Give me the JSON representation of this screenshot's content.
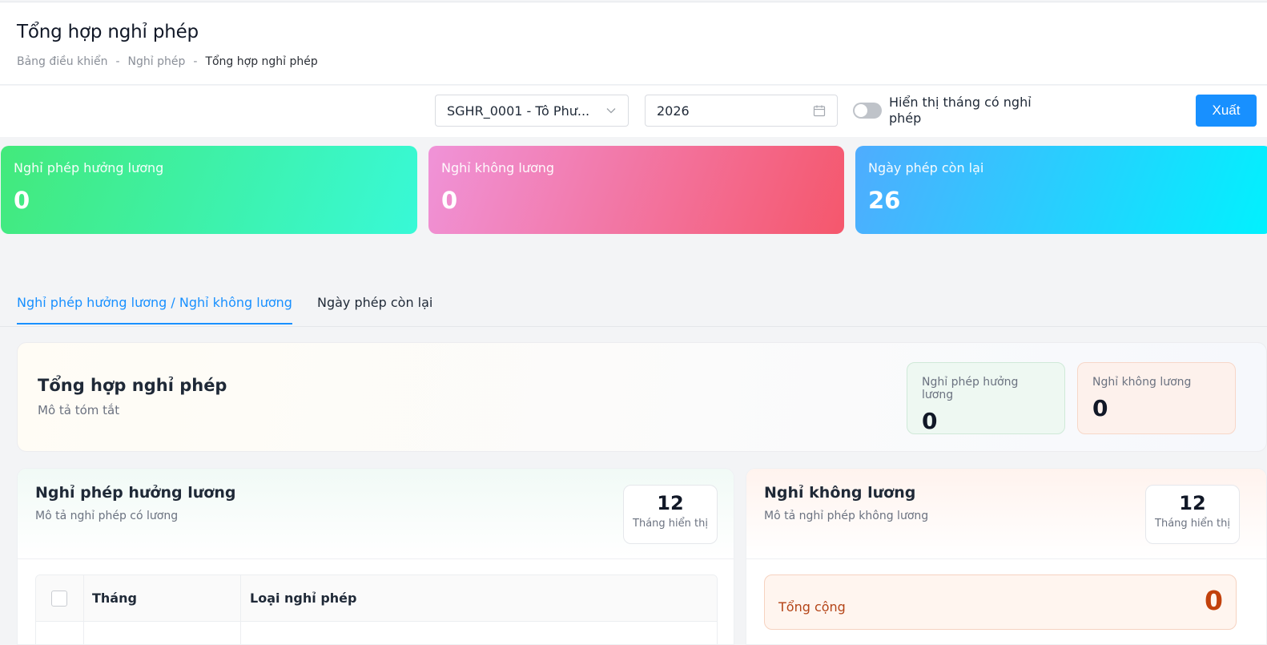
{
  "header": {
    "title": "Tổng hợp nghỉ phép",
    "breadcrumb": [
      "Bảng điều khiển",
      "Nghỉ phép",
      "Tổng hợp nghỉ phép"
    ],
    "breadcrumb_sep": "-"
  },
  "filters": {
    "employee_select": "SGHR_0001 - Tô Phư...",
    "year": "2026",
    "toggle_label": "Hiển thị tháng có nghỉ phép",
    "toggle_on": false,
    "export_label": "Xuất"
  },
  "stats": [
    {
      "label": "Nghỉ phép hưởng lương",
      "value": "0"
    },
    {
      "label": "Nghỉ không lương",
      "value": "0"
    },
    {
      "label": "Ngày phép còn lại",
      "value": "26"
    }
  ],
  "tabs": [
    {
      "label": "Nghỉ phép hưởng lương / Nghỉ không lương",
      "active": true
    },
    {
      "label": "Ngày phép còn lại",
      "active": false
    }
  ],
  "summary": {
    "title": "Tổng hợp nghỉ phép",
    "description": "Mô tả tóm tắt",
    "paid": {
      "label": "Nghỉ phép hưởng lương",
      "value": "0"
    },
    "unpaid": {
      "label": "Nghỉ không lương",
      "value": "0"
    }
  },
  "paid_panel": {
    "title": "Nghỉ phép hưởng lương",
    "description": "Mô tả nghỉ phép có lương",
    "count": "12",
    "count_caption": "Tháng hiển thị",
    "columns": [
      "Tháng",
      "Loại nghỉ phép"
    ]
  },
  "unpaid_panel": {
    "title": "Nghỉ không lương",
    "description": "Mô tả nghỉ phép không lương",
    "count": "12",
    "count_caption": "Tháng hiển thị",
    "total_label": "Tổng cộng",
    "total_value": "0"
  },
  "colors": {
    "primary": "#1890ff",
    "green_card": "#43e97b",
    "pink_card": "#f5576c",
    "blue_card": "#4facfe",
    "total_accent": "#c2410c"
  },
  "icons": {
    "select_chevron": "chevron-down-icon",
    "date_picker": "calendar-icon"
  }
}
